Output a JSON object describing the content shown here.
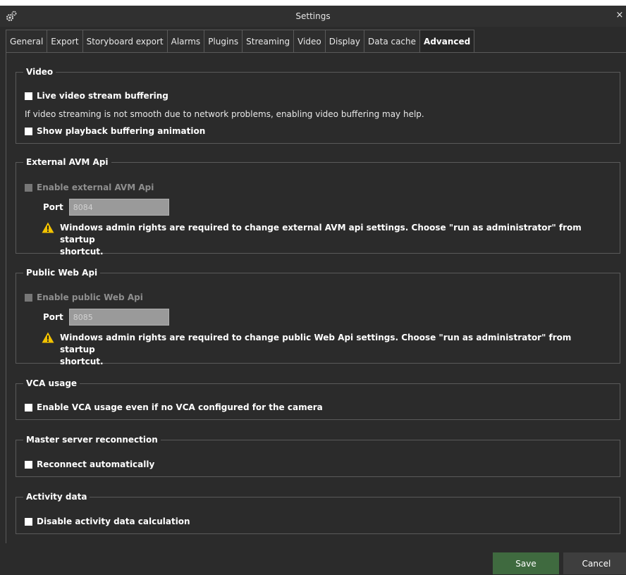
{
  "window": {
    "title": "Settings",
    "app_icon": "gears-icon",
    "close_label": "×"
  },
  "tabs": [
    {
      "label": "General"
    },
    {
      "label": "Export"
    },
    {
      "label": "Storyboard export"
    },
    {
      "label": "Alarms"
    },
    {
      "label": "Plugins"
    },
    {
      "label": "Streaming"
    },
    {
      "label": "Video"
    },
    {
      "label": "Display"
    },
    {
      "label": "Data cache"
    },
    {
      "label": "Advanced",
      "active": true
    }
  ],
  "video": {
    "title": "Video",
    "live_buffering": {
      "label": "Live video stream buffering",
      "checked": false
    },
    "hint": "If video streaming is not smooth due to network problems, enabling video buffering may help.",
    "playback_animation": {
      "label": "Show playback buffering animation",
      "checked": false
    }
  },
  "external_avm": {
    "title": "External AVM Api",
    "enable": {
      "label": "Enable external AVM Api",
      "checked": false,
      "disabled": true
    },
    "port_label": "Port",
    "port_value": "8084",
    "warning_line1": "Windows admin rights are required to change external AVM api settings. Choose \"run as administrator\" from startup",
    "warning_line2": "shortcut."
  },
  "public_web": {
    "title": "Public Web Api",
    "enable": {
      "label": "Enable public Web Api",
      "checked": false,
      "disabled": true
    },
    "port_label": "Port",
    "port_value": "8085",
    "warning_line1": "Windows admin rights are required to change public Web Api settings. Choose \"run as administrator\" from startup",
    "warning_line2": "shortcut."
  },
  "vca": {
    "title": "VCA usage",
    "enable": {
      "label": "Enable VCA usage even if no VCA configured for the camera",
      "checked": false
    }
  },
  "master": {
    "title": "Master server reconnection",
    "reconnect": {
      "label": "Reconnect automatically",
      "checked": false
    }
  },
  "activity": {
    "title": "Activity data",
    "disable": {
      "label": "Disable activity data calculation",
      "checked": false
    }
  },
  "footer": {
    "save_label": "Save",
    "cancel_label": "Cancel"
  },
  "colors": {
    "accent_save": "#3f6a3f",
    "warning": "#f2c200",
    "background": "#2b2b2b"
  }
}
